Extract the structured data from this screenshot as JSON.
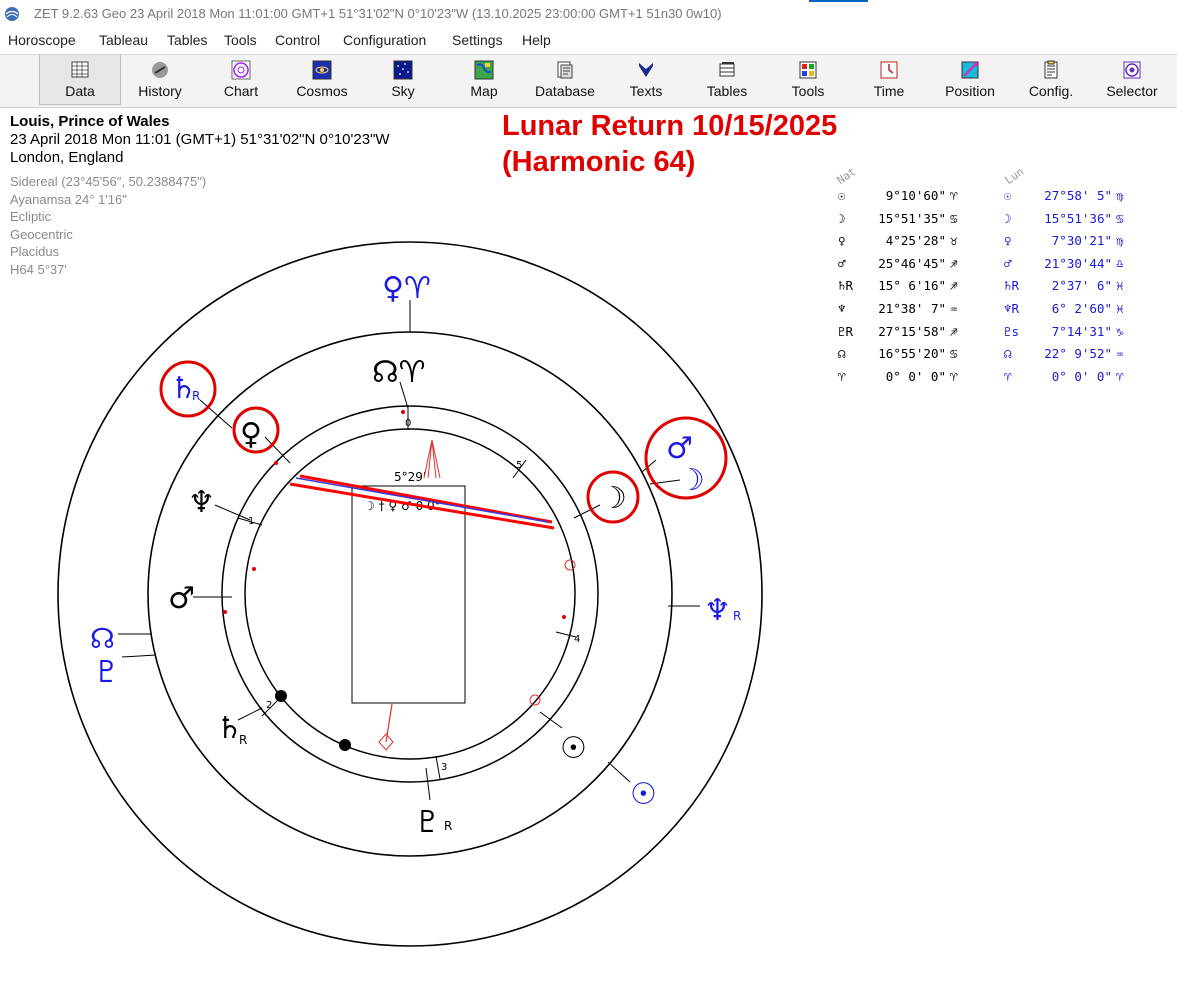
{
  "window": {
    "title": "ZET 9.2.63 Geo   23 April 2018  Mon  11:01:00 GMT+1 51°31'02\"N  0°10'23\"W  (13.10.2025  23:00:00 GMT+1 51n30 0w10)"
  },
  "menu": [
    "Horoscope",
    "Tableau",
    "Tables",
    "Tools",
    "Control",
    "Configuration",
    "Settings",
    "Help"
  ],
  "toolbar": [
    {
      "label": "Data",
      "icon": "data-icon"
    },
    {
      "label": "History",
      "icon": "history-icon"
    },
    {
      "label": "Chart",
      "icon": "chart-icon"
    },
    {
      "label": "Cosmos",
      "icon": "cosmos-icon"
    },
    {
      "label": "Sky",
      "icon": "sky-icon"
    },
    {
      "label": "Map",
      "icon": "map-icon"
    },
    {
      "label": "Database",
      "icon": "database-icon"
    },
    {
      "label": "Texts",
      "icon": "texts-icon"
    },
    {
      "label": "Tables",
      "icon": "tables-icon"
    },
    {
      "label": "Tools",
      "icon": "tools-icon"
    },
    {
      "label": "Time",
      "icon": "time-icon"
    },
    {
      "label": "Position",
      "icon": "position-icon"
    },
    {
      "label": "Config.",
      "icon": "config-icon"
    },
    {
      "label": "Selector",
      "icon": "selector-icon"
    }
  ],
  "info": {
    "name": "Louis, Prince of Wales",
    "datetime": "23 April 2018  Mon  11:01 (GMT+1) 51°31'02\"N  0°10'23\"W",
    "place": "London, England",
    "settings": [
      "Sidereal (23°45'56\", 50.2388475\")",
      "Ayanamsa 24° 1'16\"",
      "Ecliptic",
      "Geocentric",
      "Placidus",
      "H64   5°37'"
    ]
  },
  "headline": [
    "Lunar Return 10/15/2025",
    "(Harmonic 64)"
  ],
  "positions": {
    "headers": [
      "Nat",
      "Lun"
    ],
    "rows": [
      {
        "nat_glyph": "☉",
        "nat_value": "9°10'60\"",
        "nat_sign": "♈",
        "lun_glyph": "☉",
        "lun_value": "27°58' 5\"",
        "lun_sign": "♍"
      },
      {
        "nat_glyph": "☽",
        "nat_value": "15°51'35\"",
        "nat_sign": "♋",
        "lun_glyph": "☽",
        "lun_value": "15°51'36\"",
        "lun_sign": "♋"
      },
      {
        "nat_glyph": "♀",
        "nat_value": "4°25'28\"",
        "nat_sign": "♉",
        "lun_glyph": "♀",
        "lun_value": "7°30'21\"",
        "lun_sign": "♍"
      },
      {
        "nat_glyph": "♂",
        "nat_value": "25°46'45\"",
        "nat_sign": "♐",
        "lun_glyph": "♂",
        "lun_value": "21°30'44\"",
        "lun_sign": "♎"
      },
      {
        "nat_glyph": "♄R",
        "nat_value": "15° 6'16\"",
        "nat_sign": "♐",
        "lun_glyph": "♄R",
        "lun_value": "2°37' 6\"",
        "lun_sign": "♓"
      },
      {
        "nat_glyph": "♆",
        "nat_value": "21°38' 7\"",
        "nat_sign": "♒",
        "lun_glyph": "♆R",
        "lun_value": "6° 2'60\"",
        "lun_sign": "♓"
      },
      {
        "nat_glyph": "♇R",
        "nat_value": "27°15'58\"",
        "nat_sign": "♐",
        "lun_glyph": "♇s",
        "lun_value": "7°14'31\"",
        "lun_sign": "♑"
      },
      {
        "nat_glyph": "☊",
        "nat_value": "16°55'20\"",
        "nat_sign": "♋",
        "lun_glyph": "☊",
        "lun_value": "22° 9'52\"",
        "lun_sign": "♒"
      },
      {
        "nat_glyph": "♈",
        "nat_value": "0° 0' 0\"",
        "nat_sign": "♈",
        "lun_glyph": "♈",
        "lun_value": "0° 0' 0\"",
        "lun_sign": "♈"
      }
    ]
  },
  "wheel": {
    "box_label": "5°29'",
    "box_glyphs": "☽ † ♀ ♂ 0  0°",
    "house_numbers": [
      "0",
      "1",
      "2",
      "3",
      "4",
      "5"
    ],
    "natal_glyphs": [
      {
        "glyph": "☊♈",
        "name": "node-aries-label"
      },
      {
        "glyph": "♀",
        "name": "natal-venus"
      },
      {
        "glyph": "♆",
        "name": "natal-neptune"
      },
      {
        "glyph": "♂",
        "name": "natal-mars"
      },
      {
        "glyph": "♄",
        "name": "natal-saturn",
        "sub": "R"
      },
      {
        "glyph": "♇",
        "name": "natal-pluto",
        "sub": "R"
      },
      {
        "glyph": "☉",
        "name": "natal-sun"
      },
      {
        "glyph": "☽",
        "name": "natal-moon"
      }
    ],
    "lunar_glyphs": [
      {
        "glyph": "♀♈",
        "name": "lunar-venus-aries"
      },
      {
        "glyph": "♄",
        "name": "lunar-saturn",
        "sub": "R"
      },
      {
        "glyph": "♂",
        "name": "lunar-mars"
      },
      {
        "glyph": "☽",
        "name": "lunar-moon"
      },
      {
        "glyph": "♆",
        "name": "lunar-neptune",
        "sub": "R"
      },
      {
        "glyph": "☊",
        "name": "lunar-node"
      },
      {
        "glyph": "♇",
        "name": "lunar-pluto"
      },
      {
        "glyph": "☉",
        "name": "lunar-sun"
      }
    ],
    "colors": {
      "natal": "#000000",
      "lunar": "#1a1ae0",
      "highlight": "#e00000"
    }
  }
}
